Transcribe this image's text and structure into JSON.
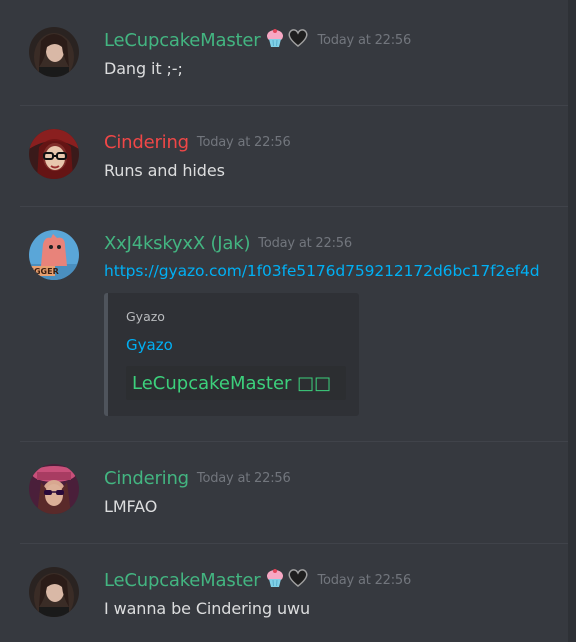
{
  "colors": {
    "background": "#36393f",
    "green_name": "#43b581",
    "red_name": "#f04747",
    "link": "#00b0f4",
    "timestamp": "#72767d",
    "text": "#dcddde"
  },
  "messages": [
    {
      "username": "LeCupcakeMaster",
      "username_color": "#43b581",
      "badges": [
        "cupcake-emoji",
        "black-heart-emoji"
      ],
      "timestamp": "Today at 22:56",
      "text": "Dang it ;-;"
    },
    {
      "username": "Cindering",
      "username_color": "#f04747",
      "badges": [],
      "timestamp": "Today at 22:56",
      "text": "Runs and hides"
    },
    {
      "username": "XxJ4kskyxX (Jak)",
      "username_color": "#43b581",
      "badges": [],
      "timestamp": "Today at 22:56",
      "text": "https://gyazo.com/1f03fe5176d759212172d6bc17f2ef4d",
      "embed": {
        "provider": "Gyazo",
        "title": "Gyazo",
        "image_text": "LeCupcakeMaster □□"
      }
    },
    {
      "username": "Cindering",
      "username_color": "#43b581",
      "badges": [],
      "timestamp": "Today at 22:56",
      "text": "LMFAO"
    },
    {
      "username": "LeCupcakeMaster",
      "username_color": "#43b581",
      "badges": [
        "cupcake-emoji",
        "black-heart-emoji"
      ],
      "timestamp": "Today at 22:56",
      "text": "I wanna be Cindering uwu"
    }
  ]
}
